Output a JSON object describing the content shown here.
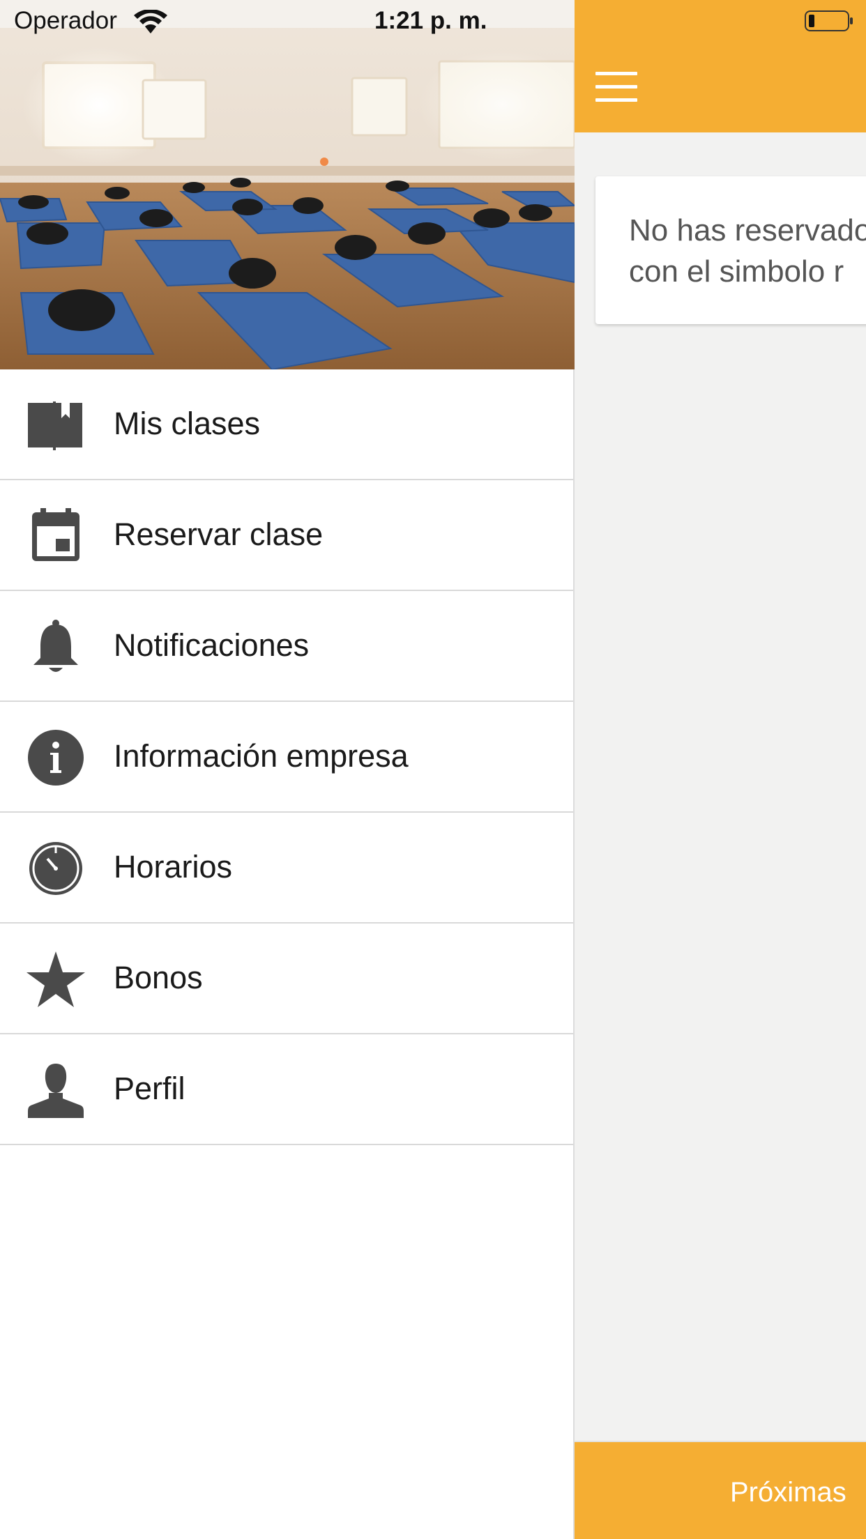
{
  "status_bar": {
    "carrier": "Operador",
    "time": "1:21 p. m."
  },
  "colors": {
    "accent": "#f5ae33",
    "main_background": "#f2f2f1",
    "icon": "#4a4a4a"
  },
  "drawer": {
    "items": [
      {
        "label": "Mis clases",
        "icon": "book-bookmark-icon"
      },
      {
        "label": "Reservar clase",
        "icon": "calendar-icon"
      },
      {
        "label": "Notificaciones",
        "icon": "bell-icon"
      },
      {
        "label": "Información empresa",
        "icon": "info-icon"
      },
      {
        "label": "Horarios",
        "icon": "clock-icon"
      },
      {
        "label": "Bonos",
        "icon": "star-icon"
      },
      {
        "label": "Perfil",
        "icon": "person-icon"
      }
    ]
  },
  "main": {
    "card_line_1": "No has reservado",
    "card_line_2": "con el simbolo r",
    "bottom_tab": "Próximas"
  }
}
